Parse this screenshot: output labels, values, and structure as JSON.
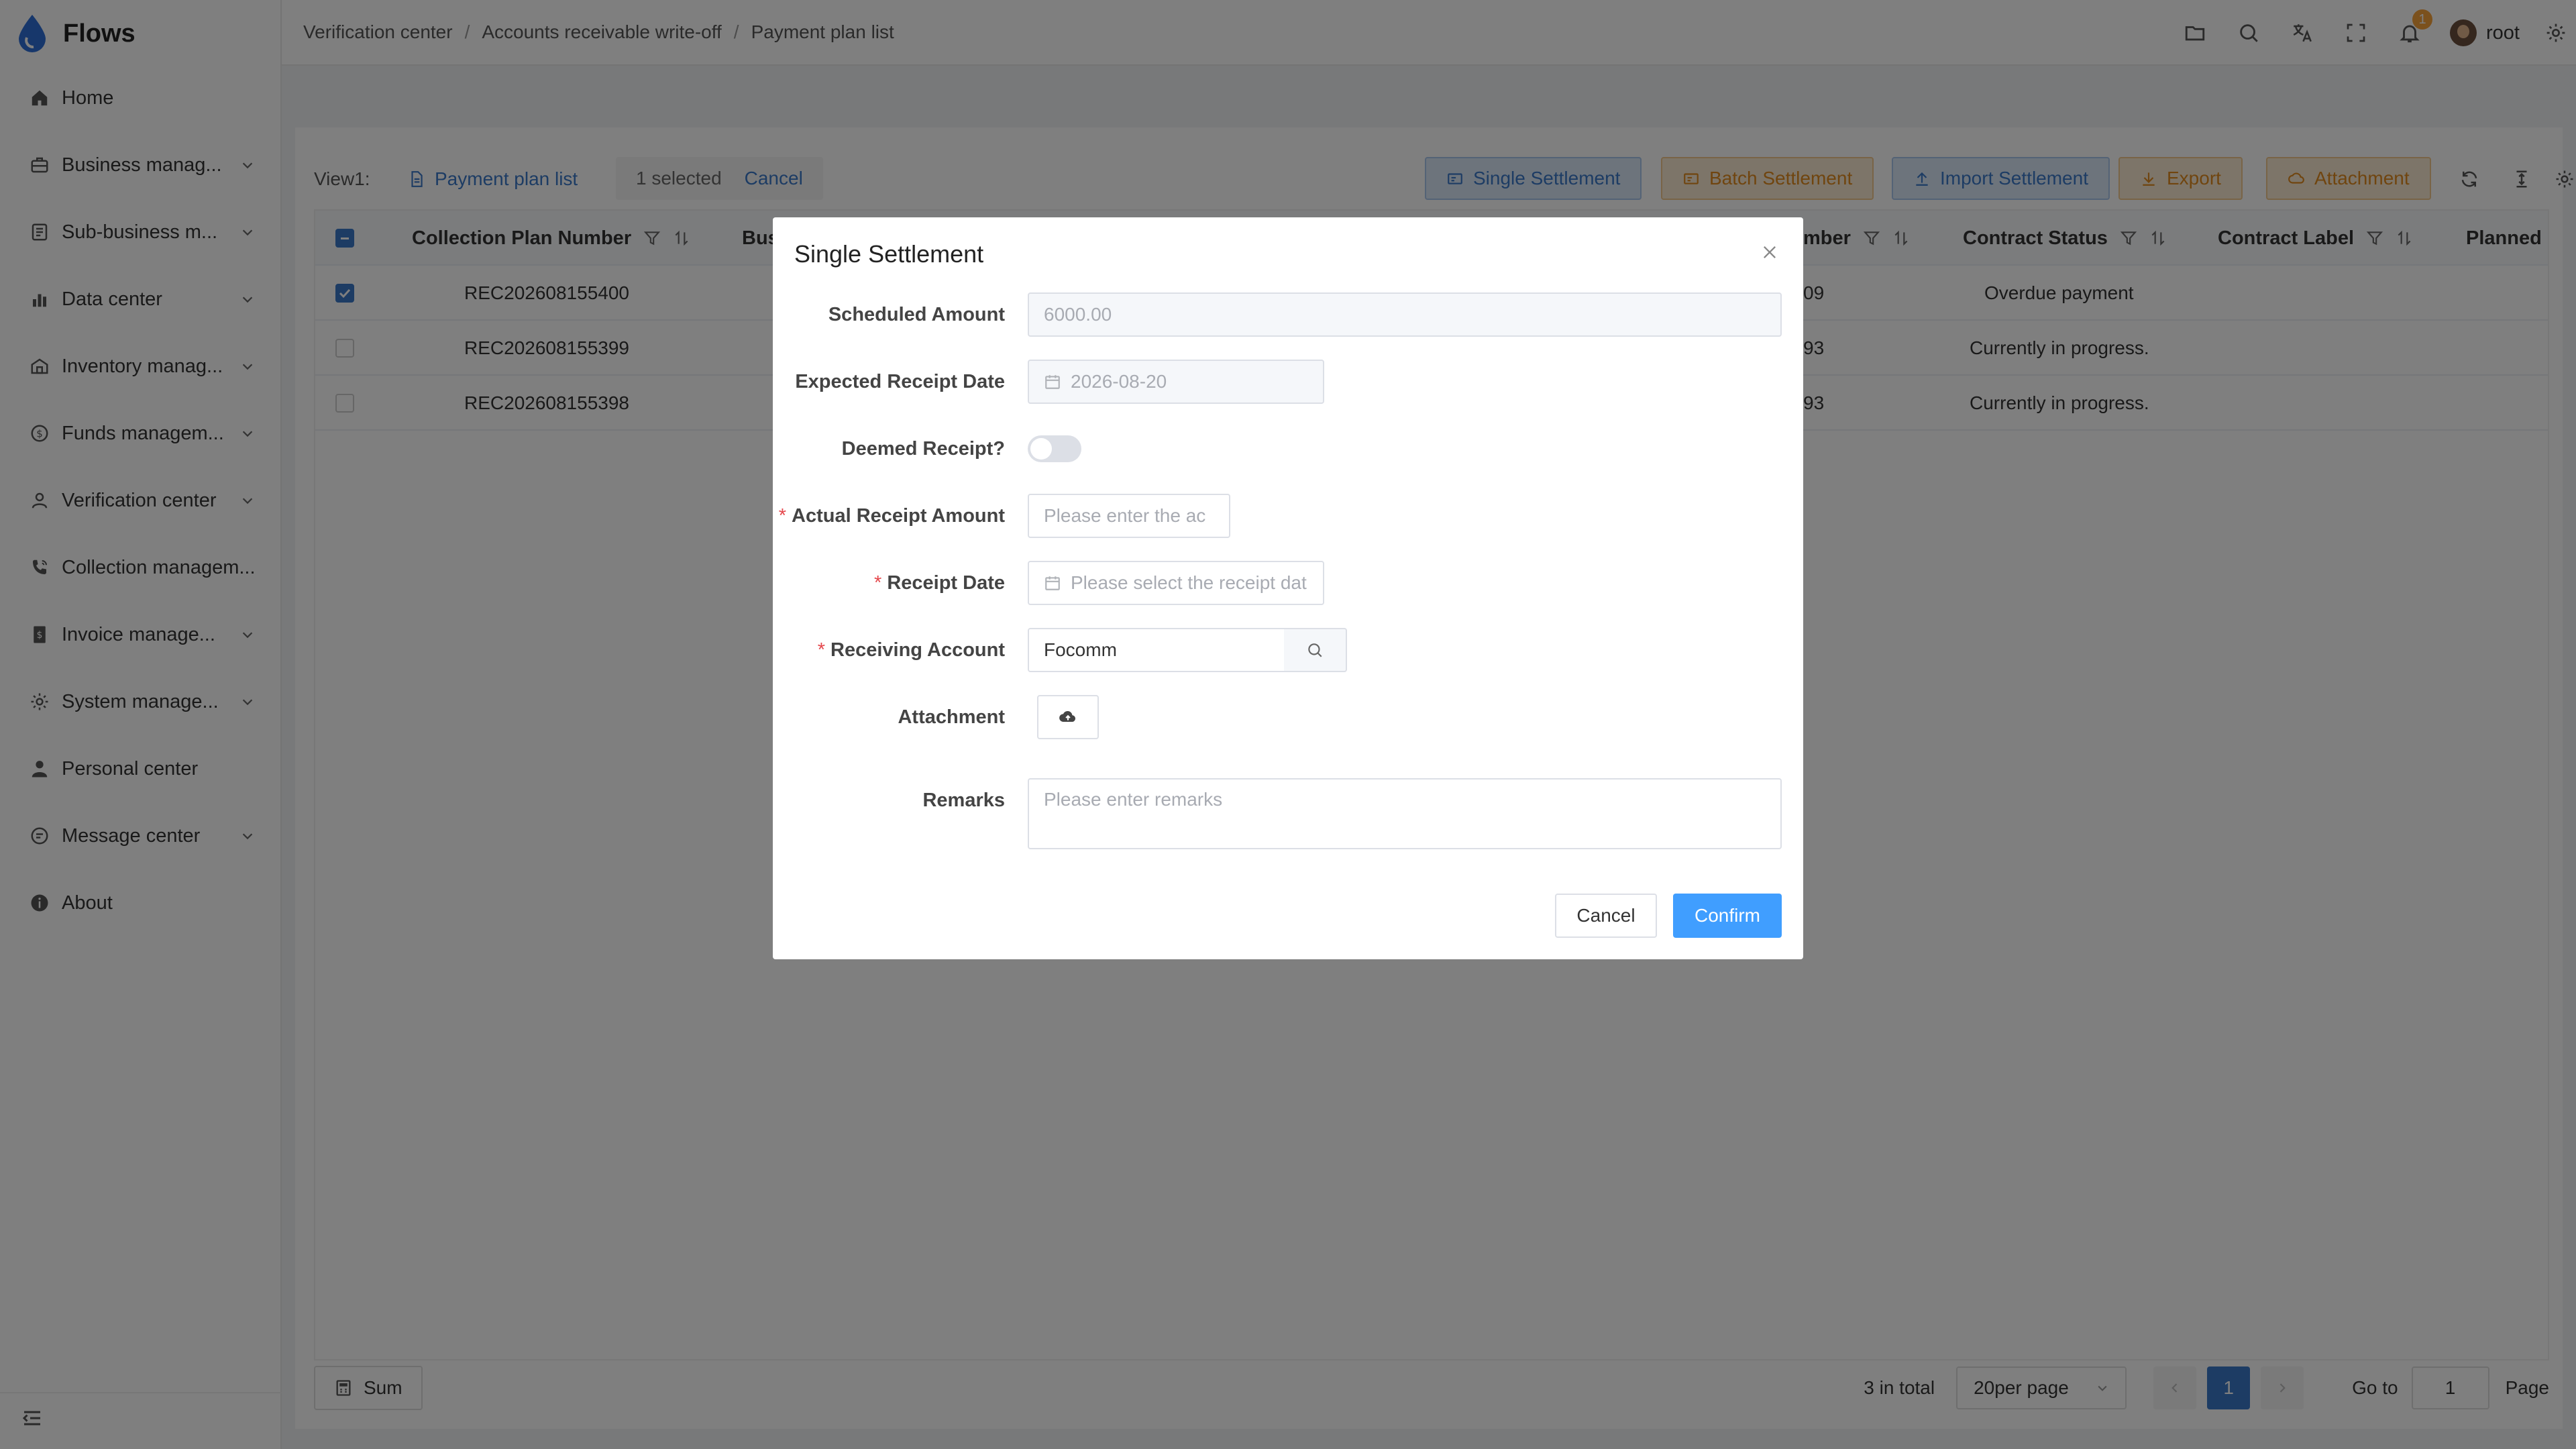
{
  "app": {
    "brand": "Flows"
  },
  "sidebar": {
    "items": [
      {
        "label": "Home",
        "icon": "home-icon",
        "expandable": false
      },
      {
        "label": "Business manag...",
        "icon": "briefcase-icon",
        "expandable": true
      },
      {
        "label": "Sub-business m...",
        "icon": "document-list-icon",
        "expandable": true
      },
      {
        "label": "Data center",
        "icon": "bar-chart-icon",
        "expandable": true
      },
      {
        "label": "Inventory manag...",
        "icon": "warehouse-icon",
        "expandable": true
      },
      {
        "label": "Funds managem...",
        "icon": "coin-icon",
        "expandable": true
      },
      {
        "label": "Verification center",
        "icon": "user-check-icon",
        "expandable": true
      },
      {
        "label": "Collection managem...",
        "icon": "phone-icon",
        "expandable": false
      },
      {
        "label": "Invoice manage...",
        "icon": "invoice-icon",
        "expandable": true
      },
      {
        "label": "System manage...",
        "icon": "gear-icon",
        "expandable": true
      },
      {
        "label": "Personal center",
        "icon": "person-icon",
        "expandable": false
      },
      {
        "label": "Message center",
        "icon": "chat-icon",
        "expandable": true
      },
      {
        "label": "About",
        "icon": "info-icon",
        "expandable": false
      }
    ]
  },
  "header": {
    "breadcrumb": [
      "Verification center",
      "Accounts receivable write-off",
      "Payment plan list"
    ],
    "notification_count": "1",
    "username": "root"
  },
  "toolbar": {
    "view_label": "View1:",
    "view_name": "Payment plan list",
    "selected_text": "1 selected",
    "cancel_label": "Cancel",
    "single_settlement": "Single Settlement",
    "batch_settlement": "Batch Settlement",
    "import_settlement": "Import Settlement",
    "export": "Export",
    "attachment": "Attachment"
  },
  "table": {
    "columns": {
      "col1": "Collection Plan Number",
      "col2_partial": "Bus",
      "col3_partial": "mber",
      "col4": "Contract Status",
      "col5": "Contract Label",
      "col6_partial": "Planned"
    },
    "rows": [
      {
        "plan_number": "REC202608155400",
        "num_partial": "09",
        "status": "Overdue payment",
        "checked": true
      },
      {
        "plan_number": "REC202608155399",
        "num_partial": "93",
        "status": "Currently in progress.",
        "checked": false
      },
      {
        "plan_number": "REC202608155398",
        "num_partial": "93",
        "status": "Currently in progress.",
        "checked": false
      }
    ]
  },
  "footer": {
    "sum_label": "Sum",
    "total_text": "3 in total",
    "page_size": "20per page",
    "current_page": "1",
    "goto_label": "Go to",
    "goto_value": "1",
    "page_label": "Page"
  },
  "modal": {
    "title": "Single Settlement",
    "scheduled_amount_label": "Scheduled Amount",
    "scheduled_amount_value": "6000.00",
    "expected_date_label": "Expected Receipt Date",
    "expected_date_value": "2026-08-20",
    "deemed_receipt_label": "Deemed Receipt?",
    "deemed_receipt_on": false,
    "actual_amount_label": "Actual Receipt Amount",
    "actual_amount_placeholder": "Please enter the ac",
    "receipt_date_label": "Receipt Date",
    "receipt_date_placeholder": "Please select the receipt dat",
    "receiving_account_label": "Receiving Account",
    "receiving_account_value": "Focomm",
    "attachment_label": "Attachment",
    "remarks_label": "Remarks",
    "remarks_placeholder": "Please enter remarks",
    "cancel_label": "Cancel",
    "confirm_label": "Confirm"
  },
  "colors": {
    "primary": "#409eff",
    "link": "#3a78c8",
    "warning": "#e08a1e",
    "required": "#e5484d",
    "overlay": "rgba(0,0,0,0.5)"
  }
}
